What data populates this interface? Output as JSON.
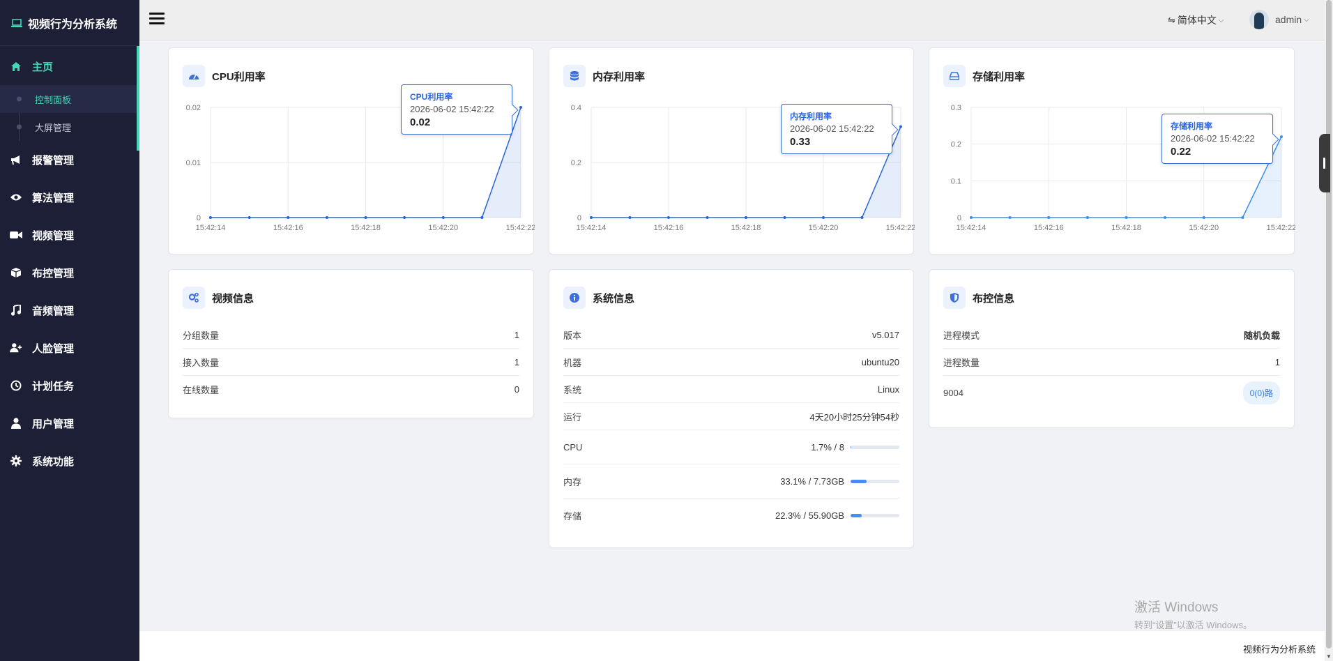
{
  "app": {
    "title": "视频行为分析系统"
  },
  "sidebar": {
    "items": [
      {
        "label": "主页",
        "icon": "home-icon"
      },
      {
        "label": "报警管理",
        "icon": "megaphone-icon"
      },
      {
        "label": "算法管理",
        "icon": "eye-icon"
      },
      {
        "label": "视频管理",
        "icon": "video-camera-icon"
      },
      {
        "label": "布控管理",
        "icon": "cube-icon"
      },
      {
        "label": "音频管理",
        "icon": "music-icon"
      },
      {
        "label": "人脸管理",
        "icon": "user-plus-icon"
      },
      {
        "label": "计划任务",
        "icon": "clock-icon"
      },
      {
        "label": "用户管理",
        "icon": "user-icon"
      },
      {
        "label": "系统功能",
        "icon": "gear-icon"
      }
    ],
    "sub_items": [
      {
        "label": "控制面板"
      },
      {
        "label": "大屏管理"
      }
    ]
  },
  "header": {
    "language": "简体中文",
    "user": "admin"
  },
  "cards": {
    "cpu": {
      "title": "CPU利用率"
    },
    "mem": {
      "title": "内存利用率"
    },
    "disk": {
      "title": "存储利用率"
    },
    "video": {
      "title": "视频信息",
      "rows": [
        {
          "label": "分组数量",
          "value": "1"
        },
        {
          "label": "接入数量",
          "value": "1"
        },
        {
          "label": "在线数量",
          "value": "0"
        }
      ]
    },
    "system": {
      "title": "系统信息",
      "rows": [
        {
          "label": "版本",
          "value": "v5.017"
        },
        {
          "label": "机器",
          "value": "ubuntu20"
        },
        {
          "label": "系统",
          "value": "Linux"
        },
        {
          "label": "运行",
          "value": "4天20小时25分钟54秒"
        },
        {
          "label": "CPU",
          "value": "1.7% / 8",
          "progress": 0.017
        },
        {
          "label": "内存",
          "value": "33.1% / 7.73GB",
          "progress": 0.331
        },
        {
          "label": "存储",
          "value": "22.3% / 55.90GB",
          "progress": 0.223
        }
      ]
    },
    "deploy": {
      "title": "布控信息",
      "rows": [
        {
          "label": "进程模式",
          "value": "随机负载"
        },
        {
          "label": "进程数量",
          "value": "1"
        },
        {
          "label": "9004",
          "value": "0(0)路"
        }
      ]
    }
  },
  "chart_data": [
    {
      "type": "area",
      "series": [
        {
          "name": "CPU利用率",
          "values": [
            0,
            0,
            0,
            0,
            0,
            0,
            0,
            0,
            0.02
          ]
        }
      ],
      "x": [
        "15:42:14",
        "",
        "15:42:16",
        "",
        "15:42:18",
        "",
        "15:42:20",
        "",
        "15:42:22"
      ],
      "xticks": [
        "15:42:14",
        "15:42:16",
        "15:42:18",
        "15:42:20",
        "15:42:22"
      ],
      "yticks": [
        "0",
        "0.01",
        "0.02"
      ],
      "ylim": [
        0,
        0.02
      ],
      "tooltip": {
        "name": "CPU利用率",
        "time": "2026-06-02 15:42:22",
        "value": "0.02"
      },
      "color": "#2b65d9"
    },
    {
      "type": "area",
      "series": [
        {
          "name": "内存利用率",
          "values": [
            0,
            0,
            0,
            0,
            0,
            0,
            0,
            0,
            0.33
          ]
        }
      ],
      "x": [
        "15:42:14",
        "",
        "15:42:16",
        "",
        "15:42:18",
        "",
        "15:42:20",
        "",
        "15:42:22"
      ],
      "xticks": [
        "15:42:14",
        "15:42:16",
        "15:42:18",
        "15:42:20",
        "15:42:22"
      ],
      "yticks": [
        "0",
        "0.2",
        "0.4"
      ],
      "ylim": [
        0,
        0.4
      ],
      "tooltip": {
        "name": "内存利用率",
        "time": "2026-06-02 15:42:22",
        "value": "0.33"
      },
      "color": "#2b65d9"
    },
    {
      "type": "area",
      "series": [
        {
          "name": "存储利用率",
          "values": [
            0,
            0,
            0,
            0,
            0,
            0,
            0,
            0,
            0.22
          ]
        }
      ],
      "x": [
        "15:42:14",
        "",
        "15:42:16",
        "",
        "15:42:18",
        "",
        "15:42:20",
        "",
        "15:42:22"
      ],
      "xticks": [
        "15:42:14",
        "15:42:16",
        "15:42:18",
        "15:42:20",
        "15:42:22"
      ],
      "yticks": [
        "0",
        "0.1",
        "0.2",
        "0.3"
      ],
      "ylim": [
        0,
        0.3
      ],
      "tooltip": {
        "name": "存储利用率",
        "time": "2026-06-02 15:42:22",
        "value": "0.22"
      },
      "color": "#3a8ef0"
    }
  ],
  "footer": {
    "text": "视频行为分析系统"
  },
  "watermark": {
    "line1": "激活 Windows",
    "line2": "转到“设置”以激活 Windows。"
  }
}
